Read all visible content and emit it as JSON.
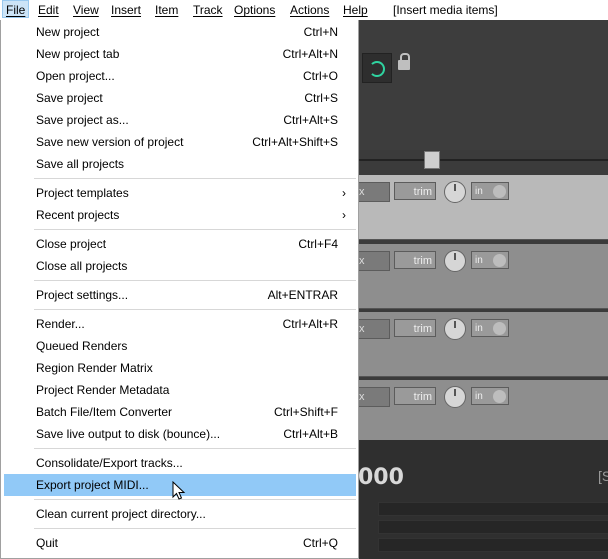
{
  "menubar": {
    "items": [
      {
        "label": "File"
      },
      {
        "label": "Edit"
      },
      {
        "label": "View"
      },
      {
        "label": "Insert"
      },
      {
        "label": "Item"
      },
      {
        "label": "Track"
      },
      {
        "label": "Options"
      },
      {
        "label": "Actions"
      },
      {
        "label": "Help"
      }
    ],
    "status": "[Insert media items]"
  },
  "file_menu": {
    "items": [
      {
        "label": "New project",
        "shortcut": "Ctrl+N"
      },
      {
        "label": "New project tab",
        "shortcut": "Ctrl+Alt+N"
      },
      {
        "label": "Open project...",
        "shortcut": "Ctrl+O"
      },
      {
        "label": "Save project",
        "shortcut": "Ctrl+S"
      },
      {
        "label": "Save project as...",
        "shortcut": "Ctrl+Alt+S"
      },
      {
        "label": "Save new version of project",
        "shortcut": "Ctrl+Alt+Shift+S"
      },
      {
        "label": "Save all projects",
        "shortcut": ""
      },
      {
        "label": "Project templates",
        "submenu_arrow": "›"
      },
      {
        "label": "Recent projects",
        "submenu_arrow": "›"
      },
      {
        "label": "Close project",
        "shortcut": "Ctrl+F4"
      },
      {
        "label": "Close all projects",
        "shortcut": ""
      },
      {
        "label": "Project settings...",
        "shortcut": "Alt+ENTRAR"
      },
      {
        "label": "Render...",
        "shortcut": "Ctrl+Alt+R"
      },
      {
        "label": "Queued Renders",
        "shortcut": ""
      },
      {
        "label": "Region Render Matrix",
        "shortcut": ""
      },
      {
        "label": "Project Render Metadata",
        "shortcut": ""
      },
      {
        "label": "Batch File/Item Converter",
        "shortcut": "Ctrl+Shift+F"
      },
      {
        "label": "Save live output to disk (bounce)...",
        "shortcut": "Ctrl+Alt+B"
      },
      {
        "label": "Consolidate/Export tracks...",
        "shortcut": ""
      },
      {
        "label": "Export project MIDI...",
        "shortcut": "",
        "highlighted": true
      },
      {
        "label": "Clean current project directory...",
        "shortcut": ""
      },
      {
        "label": "Quit",
        "shortcut": "Ctrl+Q"
      }
    ]
  },
  "tracks": [
    {
      "fx": "x",
      "trim": "trim",
      "input": "in"
    },
    {
      "fx": "x",
      "trim": "trim",
      "input": "in"
    },
    {
      "fx": "x",
      "trim": "trim",
      "input": "in"
    },
    {
      "fx": "x",
      "trim": "trim",
      "input": "in"
    }
  ],
  "transport": {
    "time": "000",
    "extra": "[S"
  },
  "colors": {
    "highlight": "#91c9f7",
    "accent": "#2fd3a0"
  }
}
